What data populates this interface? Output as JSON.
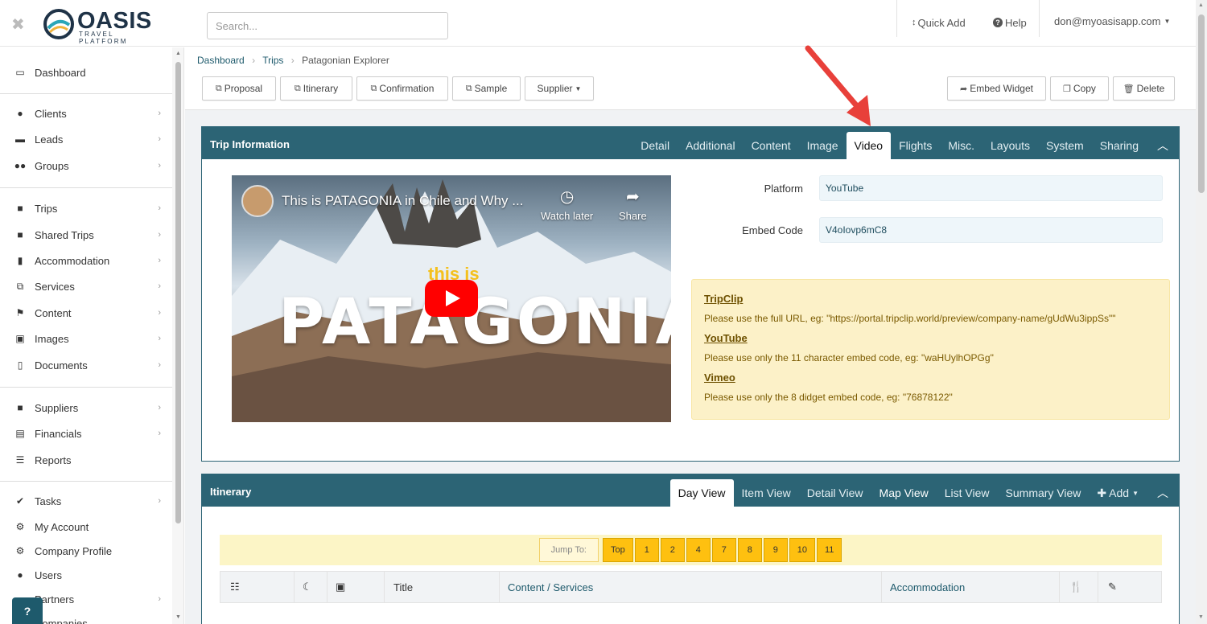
{
  "header": {
    "logo_text": "OASIS",
    "logo_subtitle": "TRAVEL PLATFORM",
    "search_placeholder": "Search...",
    "quick_add": "Quick Add",
    "help": "Help",
    "user": "don@myoasisapp.com"
  },
  "sidebar": {
    "items": [
      {
        "label": "Dashboard",
        "icon": "monitor-icon"
      },
      {
        "label": "Clients",
        "icon": "user-icon"
      },
      {
        "label": "Leads",
        "icon": "inbox-icon"
      },
      {
        "label": "Groups",
        "icon": "users-icon"
      },
      {
        "label": "Trips",
        "icon": "suitcase-icon"
      },
      {
        "label": "Shared Trips",
        "icon": "suitcase-icon"
      },
      {
        "label": "Accommodation",
        "icon": "building-icon"
      },
      {
        "label": "Services",
        "icon": "binoculars-icon"
      },
      {
        "label": "Content",
        "icon": "flag-icon"
      },
      {
        "label": "Images",
        "icon": "image-icon"
      },
      {
        "label": "Documents",
        "icon": "pdf-icon"
      },
      {
        "label": "Suppliers",
        "icon": "suitcase-icon"
      },
      {
        "label": "Financials",
        "icon": "money-icon"
      },
      {
        "label": "Reports",
        "icon": "list-icon"
      },
      {
        "label": "Tasks",
        "icon": "check-icon"
      },
      {
        "label": "My Account",
        "icon": "gear-icon"
      },
      {
        "label": "Company Profile",
        "icon": "gears-icon"
      },
      {
        "label": "Users",
        "icon": "user-icon"
      },
      {
        "label": "Partners",
        "icon": "users-icon"
      },
      {
        "label": "Companies",
        "icon": "building-icon"
      }
    ],
    "help_button": "?"
  },
  "breadcrumb": {
    "dashboard": "Dashboard",
    "trips": "Trips",
    "current": "Patagonian Explorer"
  },
  "toolbar": {
    "proposal": "Proposal",
    "itinerary": "Itinerary",
    "confirmation": "Confirmation",
    "sample": "Sample",
    "supplier": "Supplier",
    "embed_widget": "Embed Widget",
    "copy": "Copy",
    "delete": "Delete"
  },
  "trip_info": {
    "title": "Trip Information",
    "tabs": [
      "Detail",
      "Additional",
      "Content",
      "Image",
      "Video",
      "Flights",
      "Misc.",
      "Layouts",
      "System",
      "Sharing"
    ],
    "active_tab": "Video",
    "video": {
      "title": "This is PATAGONIA in Chile and Why ...",
      "watch_later": "Watch later",
      "share": "Share",
      "overlay_small": "this is",
      "overlay_big": "PATAGONIA"
    },
    "platform_label": "Platform",
    "platform_value": "YouTube",
    "embed_label": "Embed Code",
    "embed_value": "V4oIovp6mC8",
    "help": {
      "tripclip_h": "TripClip",
      "tripclip_p": "Please use the full URL, eg: \"https://portal.tripclip.world/preview/company-name/gUdWu3ippSs\"\"",
      "youtube_h": "YouTube",
      "youtube_p": "Please use only the 11 character embed code, eg: \"waHUylhOPGg\"",
      "vimeo_h": "Vimeo",
      "vimeo_p": "Please use only the 8 didget embed code, eg: \"76878122\""
    }
  },
  "itinerary": {
    "title": "Itinerary",
    "tabs": [
      "Day View",
      "Item View",
      "Detail View",
      "Map View",
      "List View",
      "Summary View"
    ],
    "active_tab": "Day View",
    "add": "Add",
    "jump_label": "Jump To:",
    "jump_buttons": [
      "Top",
      "1",
      "2",
      "4",
      "7",
      "8",
      "9",
      "10",
      "11"
    ],
    "columns": {
      "title": "Title",
      "content": "Content / Services",
      "accommodation": "Accommodation"
    }
  },
  "colors": {
    "panel_header": "#2c6475",
    "accent": "#1e5a6c",
    "jump_button": "#fec010",
    "alert_bg": "#fcf1c8",
    "annotation_arrow": "#e8403a"
  }
}
